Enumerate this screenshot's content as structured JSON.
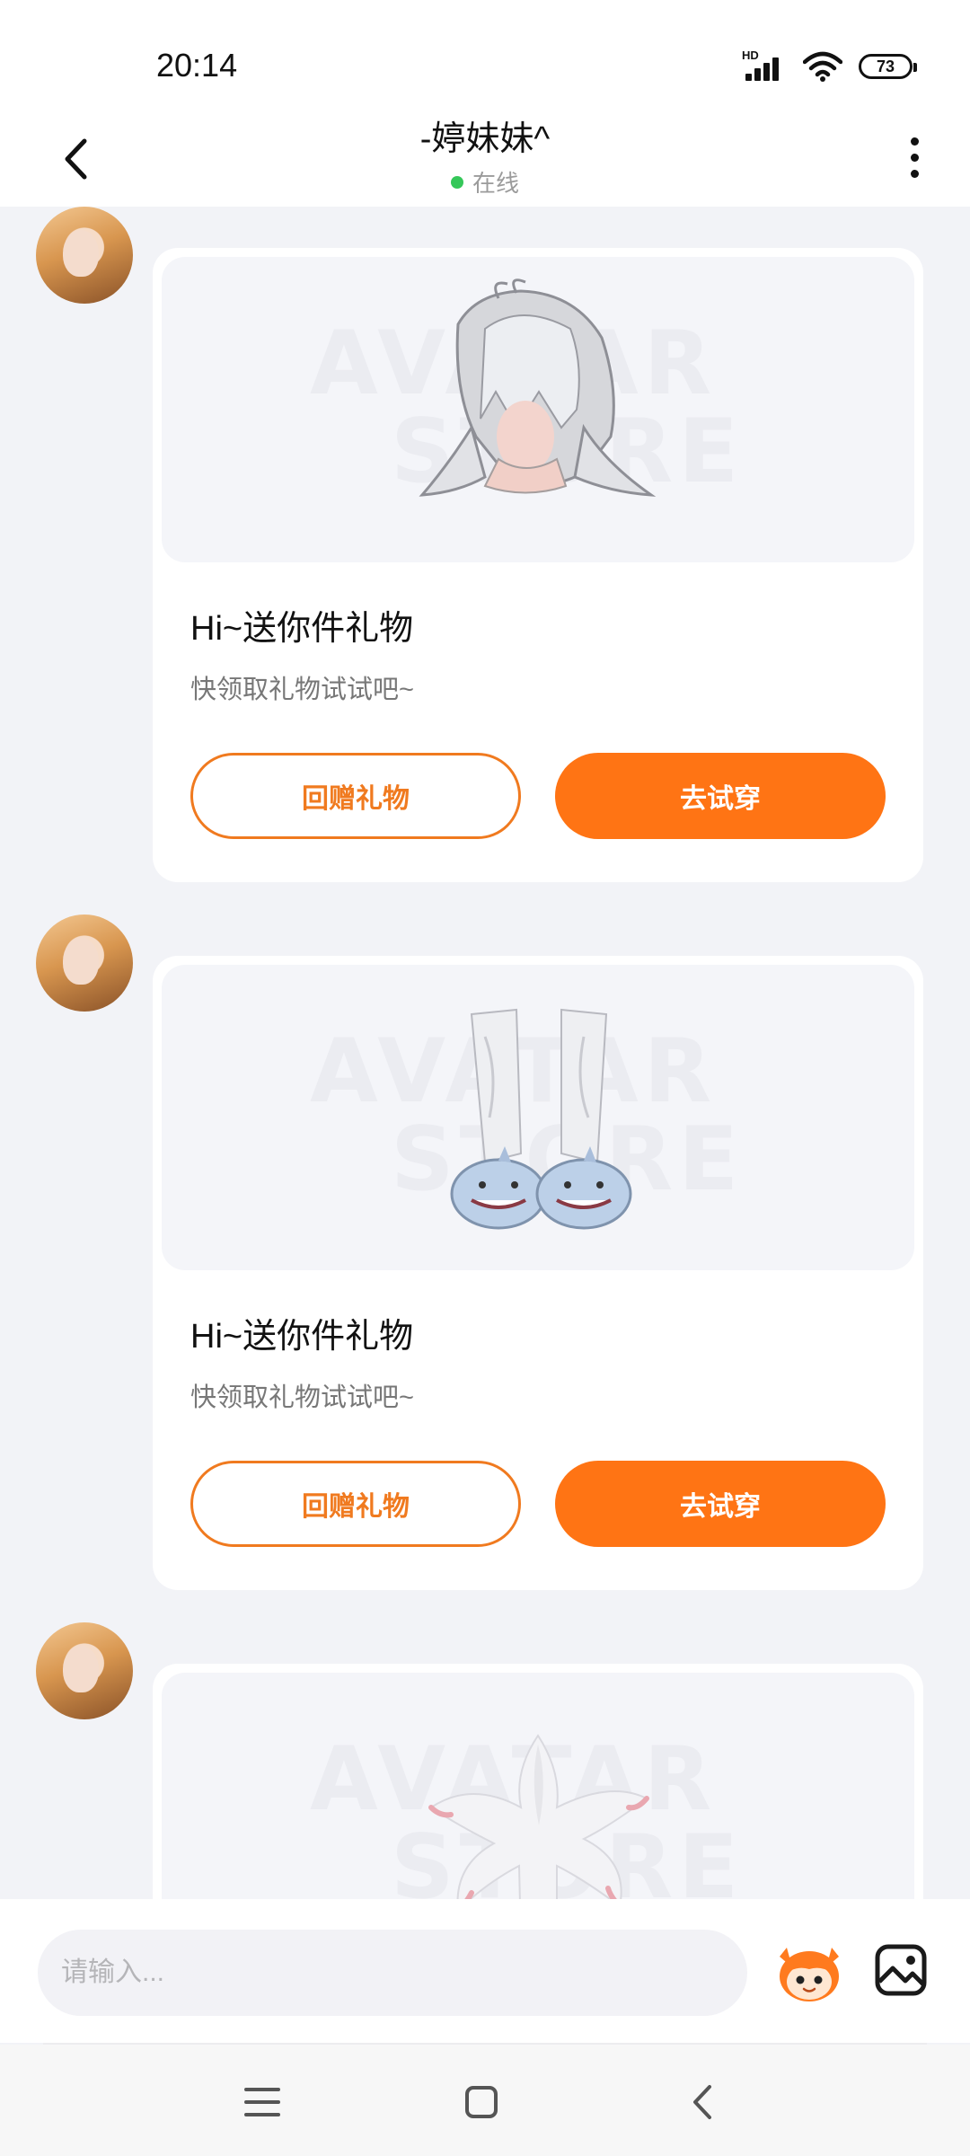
{
  "status_bar": {
    "time": "20:14",
    "network_label": "HD",
    "battery": "73",
    "icons": [
      "signal-icon",
      "wifi-icon",
      "battery-icon"
    ]
  },
  "header": {
    "title": "-婷妹妹^",
    "status": "在线",
    "status_color": "#35c759",
    "icons": [
      "back-arrow-icon",
      "more-vertical-icon"
    ]
  },
  "messages": [
    {
      "gift_image": "white-hair-wig",
      "watermark": [
        "AVATAR",
        "STORE"
      ],
      "title": "Hi~送你件礼物",
      "subtitle": "快领取礼物试试吧~",
      "return_gift_label": "回赠礼物",
      "try_on_label": "去试穿"
    },
    {
      "gift_image": "white-pants-shark-slippers",
      "watermark": [
        "AVATAR",
        "STORE"
      ],
      "title": "Hi~送你件礼物",
      "subtitle": "快领取礼物试试吧~",
      "return_gift_label": "回赠礼物",
      "try_on_label": "去试穿"
    },
    {
      "gift_image": "white-flower-hair-accessory",
      "watermark": [
        "AVATAR",
        "STORE"
      ]
    }
  ],
  "input_bar": {
    "placeholder": "请输入...",
    "icons": [
      "mascot-emoji-icon",
      "image-picker-icon"
    ]
  },
  "nav_bar": {
    "icons": [
      "menu-icon",
      "home-icon",
      "back-icon"
    ]
  },
  "colors": {
    "accent": "#ff7414",
    "outline": "#f07a1f",
    "background": "#f2f3f7"
  }
}
